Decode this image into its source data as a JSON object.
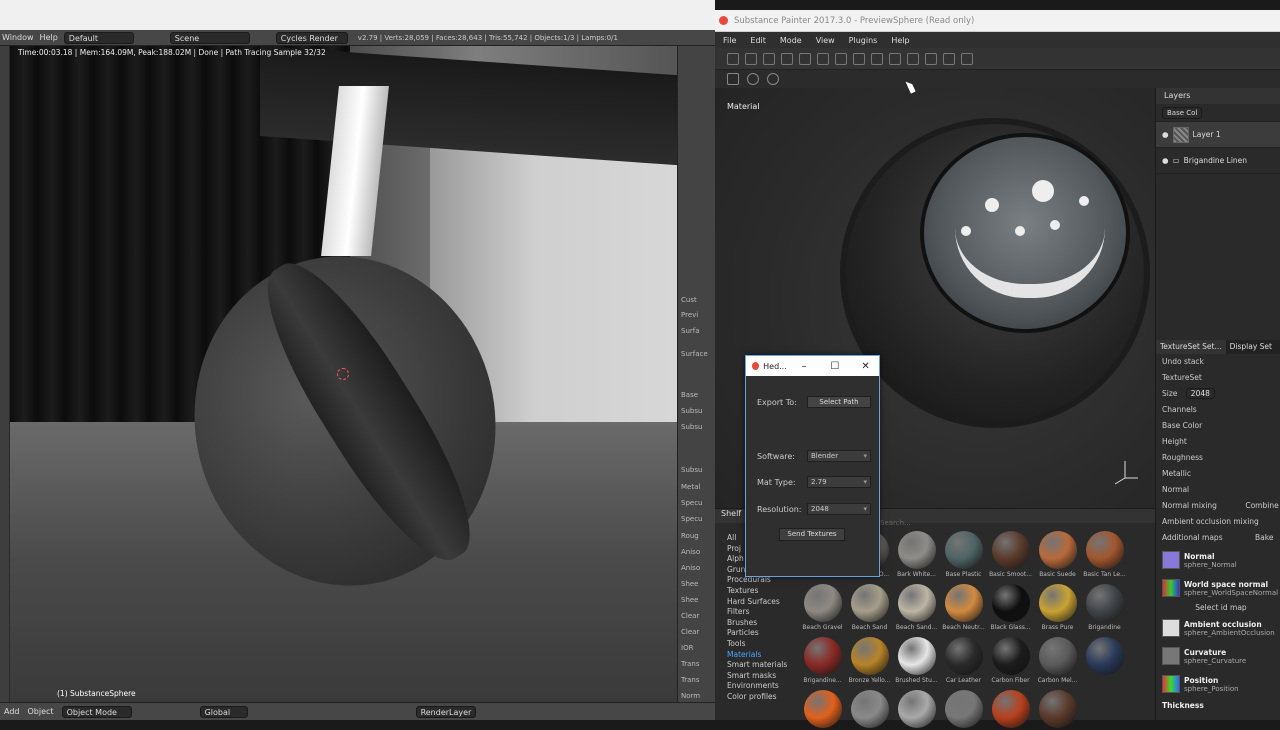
{
  "blender": {
    "top_menu": [
      "Window",
      "Help"
    ],
    "layout": "Default",
    "scene": "Scene",
    "engine": "Cycles Render",
    "stats": "v2.79 | Verts:28,059 | Faces:28,643 | Tris:55,742 | Objects:1/3 | Lamps:0/1",
    "render_info": "Time:00:03.18 | Mem:164.09M, Peak:188.02M | Done | Path Tracing Sample 32/32",
    "object_label": "(1) SubstanceSphere",
    "footer": {
      "add": "Add",
      "object": "Object",
      "mode": "Object Mode",
      "orientation": "Global",
      "render_layer": "RenderLayer"
    },
    "props_labels": [
      "Cust",
      "Previ",
      "Surfa",
      "Surface",
      "Base",
      "Subsu",
      "Subsu",
      "Subsu",
      "Metal",
      "Specu",
      "Specu",
      "Roug",
      "Aniso",
      "Aniso",
      "Shee",
      "Shee",
      "Clear",
      "Clear",
      "IOR",
      "Trans",
      "Trans",
      "Norm"
    ]
  },
  "sp": {
    "title": "Substance Painter 2017.3.0 - PreviewSphere (Read only)",
    "menu": [
      "File",
      "Edit",
      "Mode",
      "View",
      "Plugins",
      "Help"
    ],
    "viewport_label": "Material",
    "layers": {
      "header": "Layers",
      "blend_mode": "Base Col",
      "items": [
        {
          "name": "Layer 1"
        },
        {
          "name": "Brigandine Linen"
        }
      ]
    },
    "textureset": {
      "tabs": [
        "TextureSet Set...",
        "Display Set"
      ],
      "undo": "Undo stack",
      "name": "TextureSet",
      "size_label": "Size",
      "size_value": "2048",
      "channels_label": "Channels",
      "channels": [
        "Base Color",
        "Height",
        "Roughness",
        "Metallic",
        "Normal"
      ],
      "normal_mixing_label": "Normal mixing",
      "normal_mixing_value": "Combine",
      "ao_mixing_label": "Ambient occlusion mixing",
      "additional_maps": "Additional maps",
      "bake": "Bake",
      "maps": [
        {
          "title": "Normal",
          "file": "sphere_Normal"
        },
        {
          "title": "World space normal",
          "file": "sphere_WorldSpaceNormal"
        },
        {
          "title": "Ambient occlusion",
          "file": "sphere_AmbientOcclusion"
        },
        {
          "title": "Curvature",
          "file": "sphere_Curvature"
        },
        {
          "title": "Position",
          "file": "sphere_Position"
        },
        {
          "title": "Thickness",
          "file": ""
        }
      ],
      "select_id_map": "Select id map"
    },
    "shelf": {
      "header": "Shelf",
      "search_placeholder": "Search...",
      "categories": [
        "All",
        "Proj",
        "Alph",
        "Grun",
        "Procedurals",
        "Textures",
        "Hard Surfaces",
        "Filters",
        "Brushes",
        "Particles",
        "Tools",
        "Materials",
        "Smart materials",
        "Smart masks",
        "Environments",
        "Color profiles"
      ],
      "active_category": "Materials",
      "materials": [
        {
          "name": "",
          "color": "#3a3a3a"
        },
        {
          "name": "Bark Red O...",
          "color": "#6a645e"
        },
        {
          "name": "Bark White...",
          "color": "#8e8c88"
        },
        {
          "name": "Base Plastic",
          "color": "#4f6466"
        },
        {
          "name": "Basic Smoot...",
          "color": "#5a3a2a"
        },
        {
          "name": "Basic Suede",
          "color": "#b86a3a"
        },
        {
          "name": "Basic Tan Le...",
          "color": "#a2562e"
        },
        {
          "name": "Beach Gravel",
          "color": "#8e8a82"
        },
        {
          "name": "Beach Sand",
          "color": "#a69e8a"
        },
        {
          "name": "Beach Sand...",
          "color": "#bdb5a5"
        },
        {
          "name": "Beach Neutr...",
          "color": "#d28a40"
        },
        {
          "name": "Black Glass...",
          "color": "#0f0f10"
        },
        {
          "name": "Brass Pure",
          "color": "#c9a233"
        },
        {
          "name": "Brigandine",
          "color": "#404448"
        },
        {
          "name": "Brigandine...",
          "color": "#8a2a26"
        },
        {
          "name": "Bronze Yello...",
          "color": "#b78428"
        },
        {
          "name": "Brushed Stu...",
          "color": "#e6e6e6"
        },
        {
          "name": "Car Leather",
          "color": "#2a2a2a"
        },
        {
          "name": "Carbon Fiber",
          "color": "#1c1c1c"
        },
        {
          "name": "Carbon Mel...",
          "color": "#5b5b5b"
        },
        {
          "name": "",
          "color": "#2a3a5a"
        },
        {
          "name": "",
          "color": "#e2601c"
        },
        {
          "name": "",
          "color": "#8a8a8a"
        },
        {
          "name": "",
          "color": "#aaaaaa"
        },
        {
          "name": "",
          "color": "#777777"
        },
        {
          "name": "",
          "color": "#b8401c"
        },
        {
          "name": "",
          "color": "#5a3a2a"
        }
      ]
    },
    "dialog": {
      "title": "Hed...",
      "export_label": "Export To:",
      "export_button": "Select Path",
      "software_label": "Software:",
      "software_value": "Blender",
      "mat_type_label": "Mat Type:",
      "mat_type_value": "2.79",
      "resolution_label": "Resolution:",
      "resolution_value": "2048",
      "send_button": "Send Textures"
    }
  }
}
